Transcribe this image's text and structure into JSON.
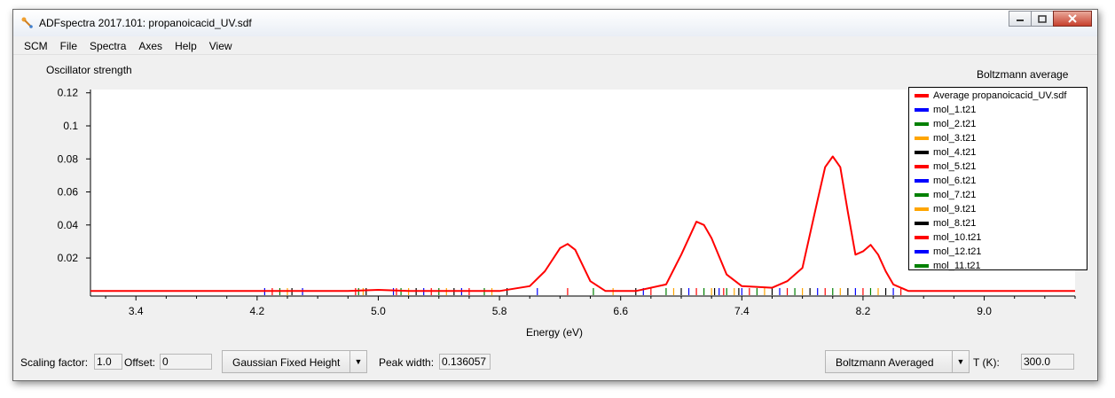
{
  "window": {
    "title": "ADFspectra 2017.101: propanoicacid_UV.sdf"
  },
  "menu": [
    "SCM",
    "File",
    "Spectra",
    "Axes",
    "Help",
    "View"
  ],
  "plot": {
    "ylabel": "Oscillator strength",
    "top_right_label": "Boltzmann average",
    "xlabel": "Energy (eV)"
  },
  "chart_data": {
    "type": "line",
    "xlabel": "Energy (eV)",
    "ylabel": "Oscillator strength",
    "xlim": [
      3.1,
      9.6
    ],
    "ylim": [
      -0.0025,
      0.122
    ],
    "xticks": [
      "3.4",
      "4.2",
      "5.0",
      "5.8",
      "6.6",
      "7.4",
      "8.2",
      "9.0"
    ],
    "yticks": [
      "0.12",
      "0.1",
      "0.08",
      "0.06",
      "0.04",
      "0.02"
    ],
    "series": [
      {
        "name": "Average propanoicacid_UV.sdf",
        "color": "#ff0000",
        "x": [
          3.1,
          4.0,
          4.8,
          5.0,
          5.2,
          5.8,
          6.0,
          6.1,
          6.2,
          6.25,
          6.3,
          6.4,
          6.5,
          6.7,
          6.9,
          7.0,
          7.1,
          7.15,
          7.2,
          7.3,
          7.4,
          7.6,
          7.7,
          7.8,
          7.9,
          7.95,
          8.0,
          8.05,
          8.1,
          8.15,
          8.2,
          8.25,
          8.3,
          8.35,
          8.4,
          8.5,
          9.0,
          9.6
        ],
        "y": [
          0.0,
          0.0,
          0.0,
          0.0007,
          0.0,
          0.0,
          0.003,
          0.012,
          0.026,
          0.0285,
          0.025,
          0.006,
          0.0,
          0.0,
          0.004,
          0.022,
          0.042,
          0.04,
          0.032,
          0.01,
          0.003,
          0.002,
          0.006,
          0.014,
          0.055,
          0.075,
          0.0815,
          0.075,
          0.048,
          0.022,
          0.024,
          0.028,
          0.022,
          0.012,
          0.004,
          0.0,
          0.0,
          0.0
        ]
      }
    ],
    "sticks": {
      "x": [
        4.25,
        4.3,
        4.35,
        4.4,
        4.43,
        4.5,
        4.85,
        4.87,
        4.9,
        4.92,
        5.1,
        5.12,
        5.15,
        5.2,
        5.25,
        5.3,
        5.35,
        5.4,
        5.45,
        5.5,
        5.55,
        5.6,
        5.7,
        5.75,
        5.85,
        6.05,
        6.25,
        6.42,
        6.55,
        6.7,
        6.75,
        6.8,
        6.9,
        6.95,
        7.0,
        7.05,
        7.1,
        7.15,
        7.2,
        7.22,
        7.25,
        7.28,
        7.3,
        7.35,
        7.38,
        7.4,
        7.45,
        7.5,
        7.55,
        7.6,
        7.65,
        7.7,
        7.75,
        7.8,
        7.85,
        7.9,
        7.95,
        8.0,
        8.05,
        8.1,
        8.15,
        8.2,
        8.25,
        8.3,
        8.35,
        8.4,
        8.45
      ],
      "colors": [
        "#0000ff",
        "#ff0000",
        "#008000",
        "#ffa500",
        "#000000",
        "#0000ff",
        "#ff0000",
        "#008000",
        "#ffa500",
        "#000000",
        "#0000ff",
        "#ff0000",
        "#008000",
        "#ffa500",
        "#000000",
        "#0000ff",
        "#ff0000",
        "#008000",
        "#ffa500",
        "#000000",
        "#0000ff",
        "#ff0000",
        "#008000",
        "#ffa500",
        "#000000",
        "#0000ff",
        "#ff0000",
        "#008000",
        "#ffa500",
        "#000000",
        "#0000ff",
        "#ff0000",
        "#008000",
        "#ffa500",
        "#000000",
        "#0000ff",
        "#ff0000",
        "#008000",
        "#ffa500",
        "#000000",
        "#0000ff",
        "#ff0000",
        "#008000",
        "#ffa500",
        "#000000",
        "#0000ff",
        "#ff0000",
        "#008000",
        "#ffa500",
        "#000000",
        "#0000ff",
        "#ff0000",
        "#008000",
        "#ffa500",
        "#000000",
        "#0000ff",
        "#ff0000",
        "#008000",
        "#ffa500",
        "#000000",
        "#0000ff",
        "#ff0000",
        "#008000",
        "#ffa500",
        "#000000",
        "#0000ff",
        "#ff0000"
      ]
    }
  },
  "legend": [
    {
      "label": "Average propanoicacid_UV.sdf",
      "color": "#ff0000"
    },
    {
      "label": "mol_1.t21",
      "color": "#0000ff"
    },
    {
      "label": "mol_2.t21",
      "color": "#008000"
    },
    {
      "label": "mol_3.t21",
      "color": "#ffa500"
    },
    {
      "label": "mol_4.t21",
      "color": "#000000"
    },
    {
      "label": "mol_5.t21",
      "color": "#ff0000"
    },
    {
      "label": "mol_6.t21",
      "color": "#0000ff"
    },
    {
      "label": "mol_7.t21",
      "color": "#008000"
    },
    {
      "label": "mol_9.t21",
      "color": "#ffa500"
    },
    {
      "label": "mol_8.t21",
      "color": "#000000"
    },
    {
      "label": "mol_10.t21",
      "color": "#ff0000"
    },
    {
      "label": "mol_12.t21",
      "color": "#0000ff"
    },
    {
      "label": "mol_11.t21",
      "color": "#008000"
    }
  ],
  "statusbar": {
    "scaling_label": "Scaling factor:",
    "scaling_value": "1.0",
    "offset_label": "Offset:",
    "offset_value": "0",
    "lineshape": "Gaussian Fixed Height",
    "peak_label": "Peak width:",
    "peak_value": "0.136057",
    "averaging": "Boltzmann Averaged",
    "temp_label": "T (K):",
    "temp_value": "300.0"
  }
}
